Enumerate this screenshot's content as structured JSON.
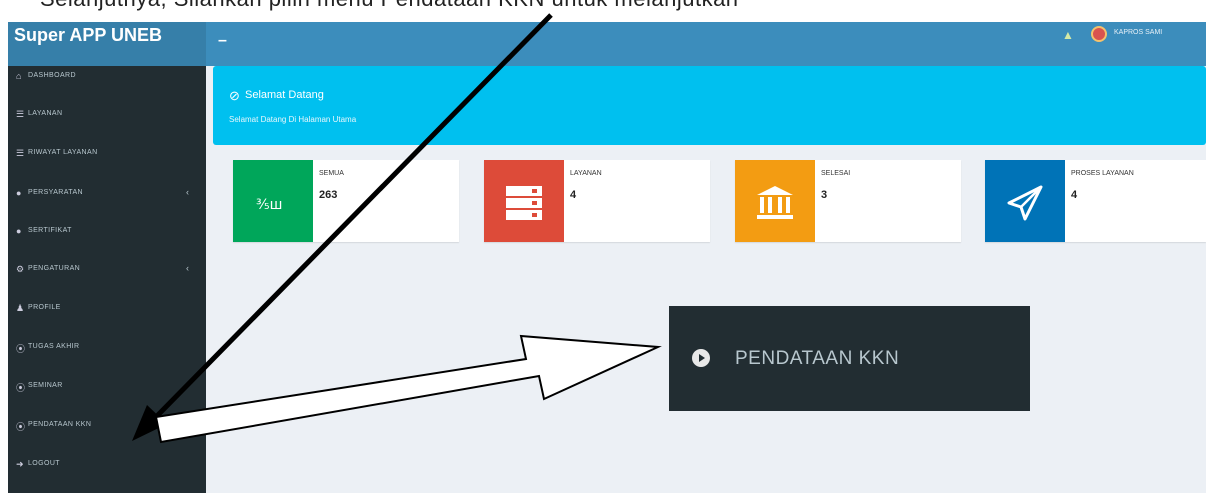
{
  "top_caption": "Selanjutnya, Silahkan pilih menu Pendataan KKN untuk melanjutkan",
  "header": {
    "brand": "Super APP UNEB",
    "menu_toggle": "≡",
    "user_name": "KAPROS SAMI"
  },
  "sidebar": {
    "items": [
      {
        "icon": "home-icon",
        "label": "DASHBOARD",
        "has_arrow": false
      },
      {
        "icon": "list-icon",
        "label": "LAYANAN",
        "has_arrow": false
      },
      {
        "icon": "history-icon",
        "label": "RIWAYAT LAYANAN",
        "has_arrow": false
      },
      {
        "icon": "users-icon",
        "label": "PERSYARATAN",
        "has_arrow": true
      },
      {
        "icon": "circle-icon",
        "label": "SERTIFIKAT",
        "has_arrow": false
      },
      {
        "icon": "settings-icon",
        "label": "PENGATURAN",
        "has_arrow": true
      },
      {
        "icon": "user-icon",
        "label": "PROFILE",
        "has_arrow": false
      },
      {
        "icon": "circle-play-icon",
        "label": "TUGAS AKHIR",
        "has_arrow": false
      },
      {
        "icon": "circle-play-icon",
        "label": "SEMINAR",
        "has_arrow": false
      },
      {
        "icon": "circle-play-icon",
        "label": "PENDATAAN KKN",
        "has_arrow": false
      },
      {
        "icon": "logout-icon",
        "label": "LOGOUT",
        "has_arrow": false
      }
    ]
  },
  "welcome": {
    "title": "Selamat Datang",
    "subtitle": "Selamat Datang Di Halaman Utama"
  },
  "stats": [
    {
      "label": "SEMUA",
      "value": "263",
      "color": "#00a65a",
      "icon": "chart-icon"
    },
    {
      "label": "LAYANAN",
      "value": "4",
      "color": "#dd4b39",
      "icon": "server-icon"
    },
    {
      "label": "SELESAI",
      "value": "3",
      "color": "#f39c12",
      "icon": "bank-icon"
    },
    {
      "label": "PROSES LAYANAN",
      "value": "4",
      "color": "#0073b7",
      "icon": "send-icon"
    }
  ],
  "callout": {
    "label": "PENDATAAN KKN"
  },
  "colors": {
    "topbar": "#3c8dbc",
    "logo_bg": "#367fa9",
    "sidebar": "#222d32",
    "welcome": "#00c0ef",
    "content_bg": "#ecf0f5"
  }
}
